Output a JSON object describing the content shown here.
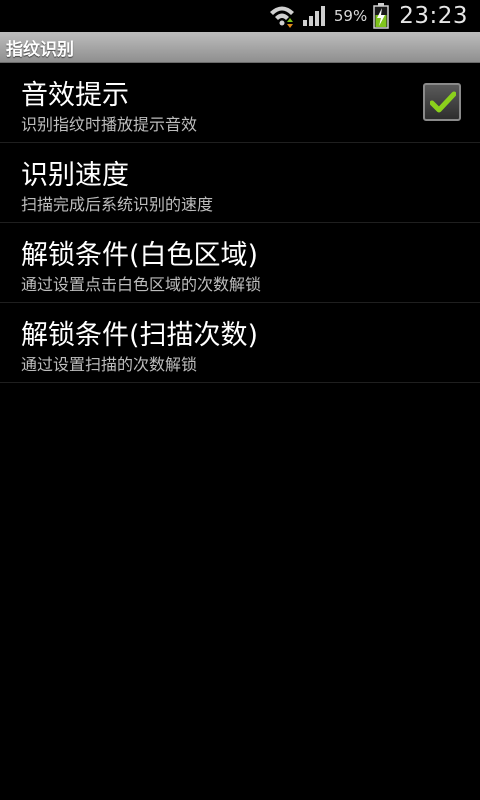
{
  "status_bar": {
    "battery_percent": "59%",
    "time": "23:23",
    "icons": [
      "wifi-icon",
      "signal-icon",
      "battery-charging-icon"
    ]
  },
  "title_bar": {
    "title": "指纹识别"
  },
  "preferences": [
    {
      "title": "音效提示",
      "summary": "识别指纹时播放提示音效",
      "checked": true
    },
    {
      "title": "识别速度",
      "summary": "扫描完成后系统识别的速度"
    },
    {
      "title": "解锁条件(白色区域)",
      "summary": "通过设置点击白色区域的次数解锁"
    },
    {
      "title": "解锁条件(扫描次数)",
      "summary": "通过设置扫描的次数解锁"
    }
  ],
  "colors": {
    "background": "#000000",
    "checkmark": "#8bd11c",
    "title_bar": "#a8a8a8"
  }
}
